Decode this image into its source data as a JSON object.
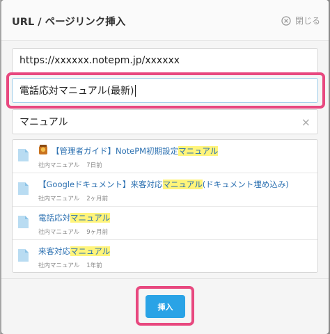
{
  "dialog": {
    "title": "URL / ページリンク挿入",
    "close_label": "閉じる"
  },
  "url_field": {
    "value": "https://xxxxxx.notepm.jp/xxxxxx"
  },
  "title_field": {
    "value": "電話応対マニュアル(最新)"
  },
  "search_field": {
    "value": "マニュアル",
    "clear_glyph": "×"
  },
  "results": [
    {
      "prefix": "【管理者ガイド】NotePM初期設定",
      "match": "マニュアル",
      "suffix": "",
      "folder": "社内マニュアル",
      "time": "7日前"
    },
    {
      "prefix": "【Googleドキュメント】来客対応",
      "match": "マニュアル",
      "suffix": "(ドキュメント埋め込み)",
      "folder": "社内マニュアル",
      "time": "2ヶ月前"
    },
    {
      "prefix": "電話応対",
      "match": "マニュアル",
      "suffix": "",
      "folder": "社内マニュアル",
      "time": "9ヶ月前"
    },
    {
      "prefix": "来客対応",
      "match": "マニュアル",
      "suffix": "",
      "folder": "社内マニュアル",
      "time": "1年前"
    }
  ],
  "insert_button": {
    "label": "挿入"
  },
  "colors": {
    "accent": "#2aa3e6",
    "highlight_box": "#e8487f",
    "match_highlight": "#fff47a",
    "link": "#2a6fb0"
  }
}
